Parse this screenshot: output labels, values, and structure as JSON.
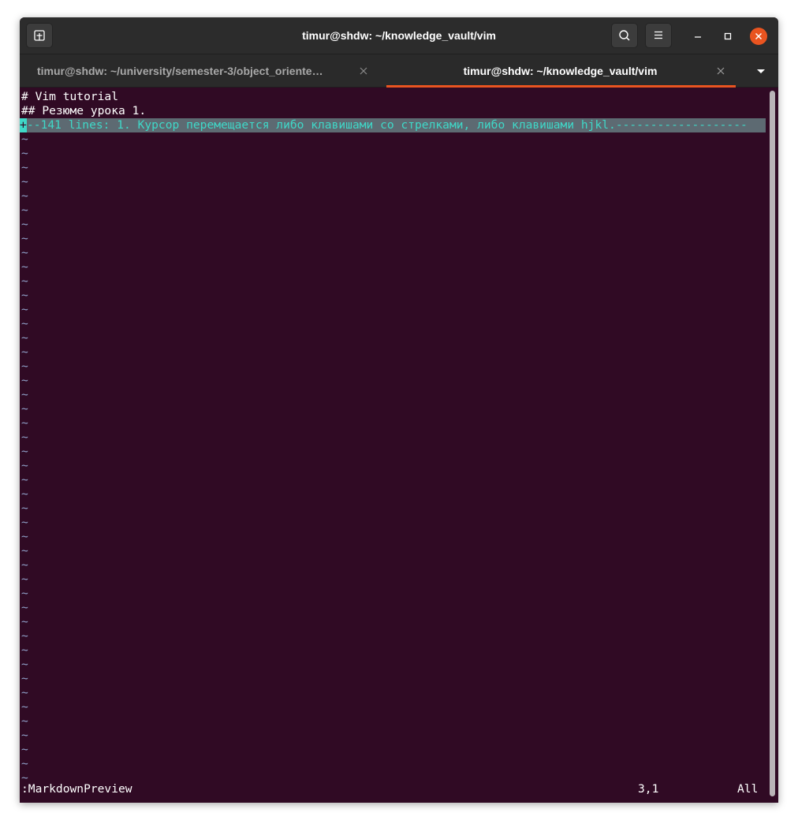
{
  "window": {
    "title": "timur@shdw: ~/knowledge_vault/vim"
  },
  "tabs": [
    {
      "label": "timur@shdw: ~/university/semester-3/object_oriente…",
      "active": false
    },
    {
      "label": "timur@shdw: ~/knowledge_vault/vim",
      "active": true
    }
  ],
  "icons": {
    "new_tab": "new-tab-icon",
    "search": "search-icon",
    "menu": "hamburger-menu-icon",
    "minimize": "minimize-icon",
    "maximize": "maximize-icon",
    "close": "close-icon",
    "tab_close": "close-icon",
    "tabs_menu": "chevron-down-icon"
  },
  "colors": {
    "terminal_bg": "#300a24",
    "fold_fg": "#3fd8c8",
    "fold_bg": "#5d6a72",
    "accent": "#e95420",
    "tilde": "#8fa0c8"
  },
  "vim": {
    "lines": [
      "# Vim tutorial",
      "## Резюме урока 1."
    ],
    "fold_cursor": "+",
    "fold_line": "--141 lines: 1. Курсор перемещается либо клавишами со стрелками, либо клавишами hjkl.-------------------",
    "tilde_char": "~",
    "command": ":MarkdownPreview",
    "position": "3,1",
    "scroll": "All"
  }
}
